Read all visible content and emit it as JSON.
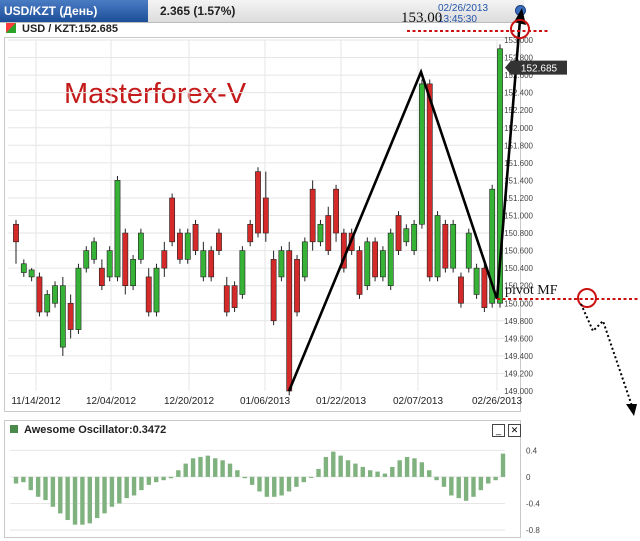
{
  "header": {
    "symbol_tab": "USD/KZT (День)",
    "change": "2.365 (1.57%)",
    "datetime": "02/26/2013 13:45:30"
  },
  "price_label": "USD / KZT:152.685",
  "watermark": "Masterforex-V",
  "annotations": {
    "target_label": "153.00",
    "pivot_label": "pivot MF",
    "current_price_tag": "152.685"
  },
  "oscillator": {
    "title": "Awesome Oscillator:0.3472",
    "minimize_label": "_",
    "close_label": "✕"
  },
  "colors": {
    "up": "#36b336",
    "down": "#d42a2a",
    "osc_bar": "#7fb27f",
    "annotation_red": "#cc1111",
    "grid": "#e6e6e6",
    "tab_blue": "#1d4e98"
  },
  "chart_data": [
    {
      "type": "candlestick",
      "x_tick_labels": [
        "11/14/2012",
        "12/04/2012",
        "12/20/2012",
        "01/06/2013",
        "01/22/2013",
        "02/07/2013",
        "02/26/2013"
      ],
      "y_tick_labels": [
        "149.000",
        "149.200",
        "149.400",
        "149.600",
        "149.800",
        "150.000",
        "150.200",
        "150.400",
        "150.600",
        "150.800",
        "151.000",
        "151.200",
        "151.400",
        "151.600",
        "151.800",
        "152.000",
        "152.200",
        "152.400",
        "152.600",
        "152.800",
        "153.000"
      ],
      "ylim": [
        149.0,
        153.0
      ],
      "grid": true,
      "last_price": 152.685,
      "candles": [
        [
          150.9,
          150.7,
          150.95,
          150.45
        ],
        [
          150.35,
          150.45,
          150.5,
          150.3
        ],
        [
          150.3,
          150.38,
          150.4,
          150.25
        ],
        [
          150.3,
          149.9,
          150.35,
          149.85
        ],
        [
          149.9,
          150.1,
          150.15,
          149.85
        ],
        [
          150.0,
          150.2,
          150.25,
          149.95
        ],
        [
          149.5,
          150.2,
          150.3,
          149.4
        ],
        [
          150.0,
          149.7,
          150.1,
          149.6
        ],
        [
          149.7,
          150.4,
          150.45,
          149.65
        ],
        [
          150.4,
          150.6,
          150.65,
          150.35
        ],
        [
          150.5,
          150.7,
          150.75,
          150.45
        ],
        [
          150.4,
          150.2,
          150.5,
          150.15
        ],
        [
          150.3,
          150.6,
          150.65,
          150.25
        ],
        [
          150.3,
          151.4,
          151.45,
          150.25
        ],
        [
          150.8,
          150.2,
          150.85,
          150.1
        ],
        [
          150.2,
          150.5,
          150.55,
          150.15
        ],
        [
          150.5,
          150.8,
          150.85,
          150.45
        ],
        [
          150.3,
          149.9,
          150.4,
          149.85
        ],
        [
          149.9,
          150.4,
          150.45,
          149.85
        ],
        [
          150.6,
          150.4,
          150.7,
          150.3
        ],
        [
          151.2,
          150.7,
          151.25,
          150.65
        ],
        [
          150.8,
          150.5,
          150.85,
          150.45
        ],
        [
          150.5,
          150.8,
          150.85,
          150.45
        ],
        [
          150.9,
          150.6,
          150.95,
          150.55
        ],
        [
          150.3,
          150.6,
          150.7,
          150.25
        ],
        [
          150.6,
          150.3,
          150.65,
          150.25
        ],
        [
          150.8,
          150.6,
          150.85,
          150.55
        ],
        [
          150.2,
          149.9,
          150.3,
          149.85
        ],
        [
          150.2,
          149.95,
          150.25,
          149.9
        ],
        [
          150.1,
          150.6,
          150.65,
          150.05
        ],
        [
          150.9,
          150.7,
          150.95,
          150.65
        ],
        [
          151.5,
          150.8,
          151.55,
          150.75
        ],
        [
          151.2,
          150.8,
          151.5,
          150.7
        ],
        [
          150.5,
          149.8,
          150.6,
          149.75
        ],
        [
          150.3,
          150.6,
          150.65,
          150.25
        ],
        [
          150.6,
          149.0,
          150.7,
          148.95
        ],
        [
          150.5,
          149.9,
          150.55,
          149.85
        ],
        [
          150.3,
          150.7,
          150.75,
          150.25
        ],
        [
          151.3,
          150.7,
          151.4,
          150.6
        ],
        [
          150.7,
          150.9,
          150.95,
          150.65
        ],
        [
          151.0,
          150.6,
          151.1,
          150.55
        ],
        [
          151.3,
          150.8,
          151.35,
          150.7
        ],
        [
          150.8,
          150.4,
          150.85,
          150.35
        ],
        [
          150.8,
          150.6,
          150.85,
          150.55
        ],
        [
          150.6,
          150.1,
          150.65,
          150.05
        ],
        [
          150.2,
          150.7,
          150.75,
          150.15
        ],
        [
          150.7,
          150.3,
          150.75,
          150.25
        ],
        [
          150.3,
          150.6,
          150.65,
          150.25
        ],
        [
          150.2,
          150.8,
          150.85,
          150.15
        ],
        [
          151.0,
          150.6,
          151.05,
          150.55
        ],
        [
          150.7,
          150.85,
          150.9,
          150.65
        ],
        [
          150.6,
          150.9,
          150.95,
          150.55
        ],
        [
          150.9,
          152.5,
          152.55,
          150.85
        ],
        [
          152.5,
          150.3,
          152.55,
          150.25
        ],
        [
          150.3,
          151.0,
          151.05,
          150.25
        ],
        [
          150.9,
          150.4,
          150.95,
          150.35
        ],
        [
          150.4,
          150.9,
          150.95,
          150.35
        ],
        [
          150.3,
          150.0,
          150.35,
          149.95
        ],
        [
          150.4,
          150.8,
          150.85,
          150.35
        ],
        [
          150.1,
          150.4,
          150.45,
          150.05
        ],
        [
          150.4,
          149.95,
          150.45,
          149.9
        ],
        [
          150.0,
          151.3,
          151.35,
          149.95
        ],
        [
          150.0,
          152.9,
          152.95,
          149.95
        ]
      ]
    },
    {
      "type": "bar",
      "name": "Awesome Oscillator",
      "y_tick_labels": [
        "0.4",
        "0",
        "-0.4",
        "-0.8"
      ],
      "ylim": [
        -0.8,
        0.45
      ],
      "values": [
        -0.1,
        -0.08,
        -0.2,
        -0.3,
        -0.35,
        -0.45,
        -0.55,
        -0.65,
        -0.72,
        -0.72,
        -0.7,
        -0.62,
        -0.55,
        -0.45,
        -0.4,
        -0.32,
        -0.28,
        -0.2,
        -0.12,
        -0.08,
        -0.05,
        -0.02,
        0.1,
        0.2,
        0.28,
        0.3,
        0.32,
        0.28,
        0.25,
        0.2,
        0.1,
        -0.02,
        -0.12,
        -0.22,
        -0.3,
        -0.3,
        -0.28,
        -0.22,
        -0.15,
        -0.08,
        0.0,
        0.12,
        0.3,
        0.38,
        0.32,
        0.25,
        0.2,
        0.15,
        0.1,
        0.08,
        0.05,
        0.15,
        0.25,
        0.3,
        0.28,
        0.22,
        0.1,
        -0.05,
        -0.15,
        -0.28,
        -0.32,
        -0.36,
        -0.3,
        -0.2,
        -0.1,
        -0.05,
        0.35
      ]
    }
  ]
}
